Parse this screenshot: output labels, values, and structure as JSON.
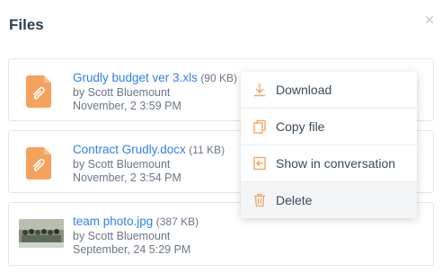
{
  "header": {
    "title": "Files",
    "close_icon": "close-icon"
  },
  "files": [
    {
      "name": "Grudly budget ver 3.xls",
      "size": "(90 KB)",
      "author": "by Scott Bluemount",
      "date": "November, 2 3:59 PM",
      "thumb": "attachment-icon"
    },
    {
      "name": "Contract Grudly.docx",
      "size": "(11 KB)",
      "author": "by Scott Bluemount",
      "date": "November, 2 3:54 PM",
      "thumb": "attachment-icon"
    },
    {
      "name": "team photo.jpg",
      "size": "(387 KB)",
      "author": "by Scott Bluemount",
      "date": "September, 24 5:29 PM",
      "thumb": "photo-thumbnail"
    }
  ],
  "context_menu": {
    "items": [
      {
        "label": "Download",
        "icon": "download-icon"
      },
      {
        "label": "Copy file",
        "icon": "copy-icon"
      },
      {
        "label": "Show in conversation",
        "icon": "show-in-conversation-icon"
      },
      {
        "label": "Delete",
        "icon": "trash-icon"
      }
    ]
  },
  "colors": {
    "accent": "#f5a25d",
    "link": "#2f80ed",
    "title": "#2c3e50"
  }
}
